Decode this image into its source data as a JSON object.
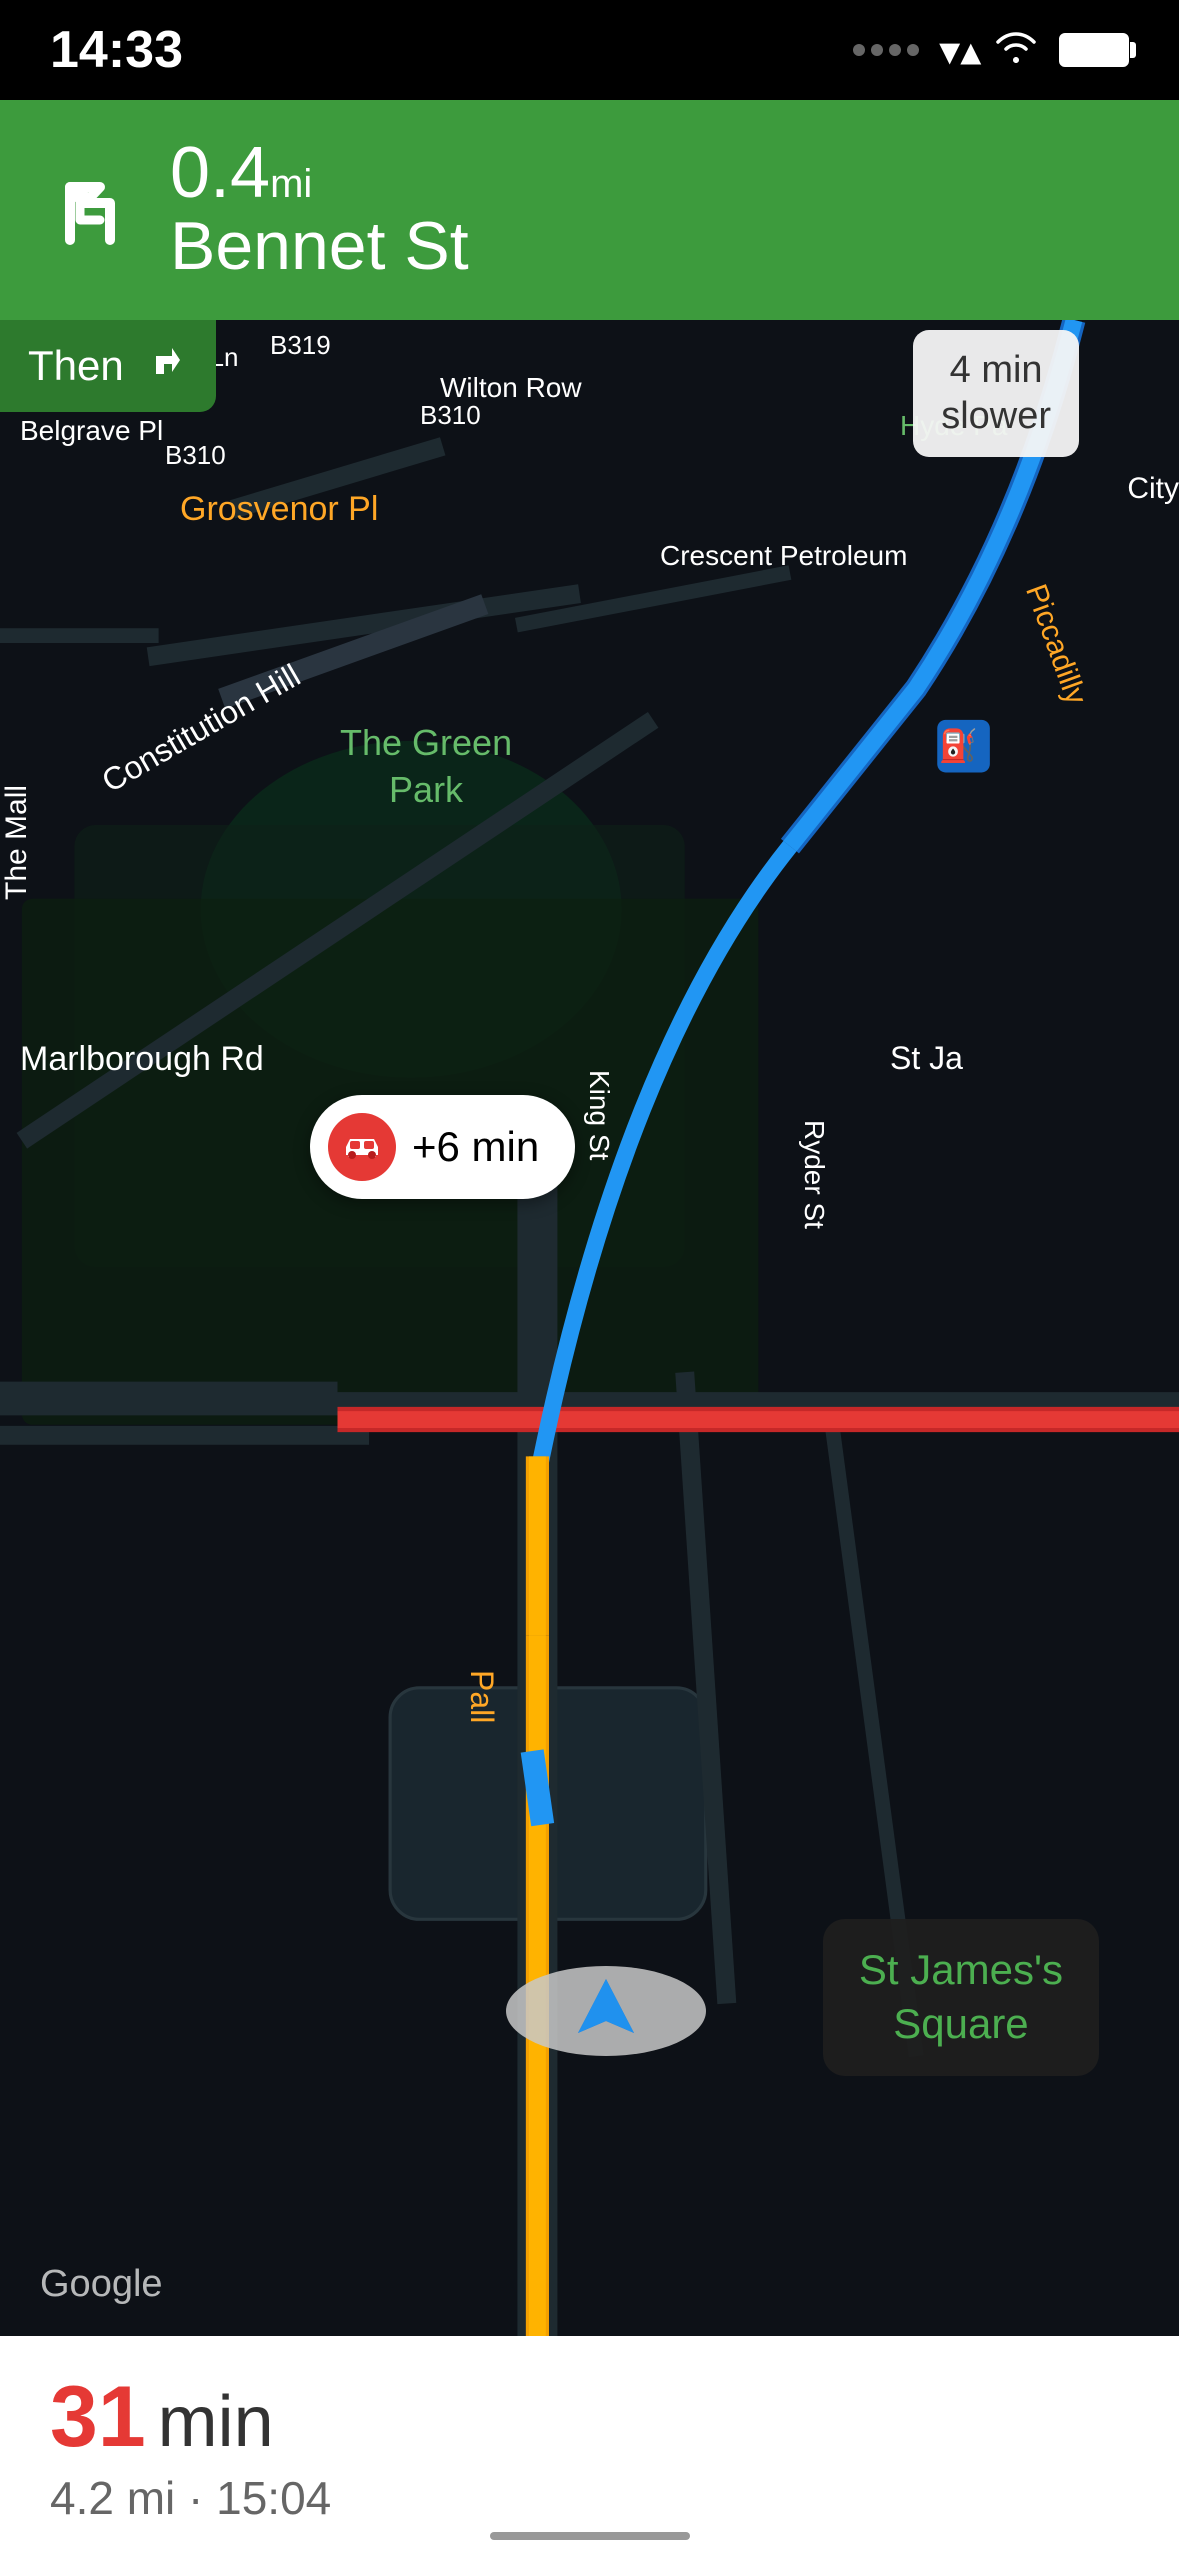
{
  "status_bar": {
    "time": "14:33",
    "battery_full": true
  },
  "nav_header": {
    "distance": "0.4",
    "unit": "mi",
    "street": "Bennet St",
    "turn_direction": "left"
  },
  "then_box": {
    "label": "Then",
    "turn_direction": "right"
  },
  "slower_badge": {
    "line1": "4 min",
    "line2": "slower"
  },
  "map": {
    "labels": [
      {
        "text": "Grosvenor Pl",
        "color": "orange"
      },
      {
        "text": "Constitution Hill",
        "color": "white"
      },
      {
        "text": "The Green Park",
        "color": "green"
      },
      {
        "text": "Belgrave Pl",
        "color": "white"
      },
      {
        "text": "Wilton Row",
        "color": "white"
      },
      {
        "text": "B310",
        "color": "white"
      },
      {
        "text": "B319",
        "color": "white"
      },
      {
        "text": "Marlborough Rd",
        "color": "white"
      },
      {
        "text": "The Mall",
        "color": "white"
      },
      {
        "text": "King St",
        "color": "white"
      },
      {
        "text": "Ryder St",
        "color": "white"
      },
      {
        "text": "St Ja",
        "color": "white"
      },
      {
        "text": "Hyde Pa",
        "color": "green"
      },
      {
        "text": "Piccadilly",
        "color": "orange"
      },
      {
        "text": "Pall",
        "color": "orange"
      },
      {
        "text": "Crescent Petroleum",
        "color": "white"
      },
      {
        "text": "Logan Ln",
        "color": "white"
      }
    ]
  },
  "delay_badge": {
    "text": "+6 min"
  },
  "st_james_label": {
    "line1": "St James's",
    "line2": "Square"
  },
  "google_watermark": "Google",
  "bottom_bar": {
    "eta_number": "31",
    "eta_unit": "min",
    "details": "4.2 mi · 15:04"
  },
  "city_label": "City"
}
